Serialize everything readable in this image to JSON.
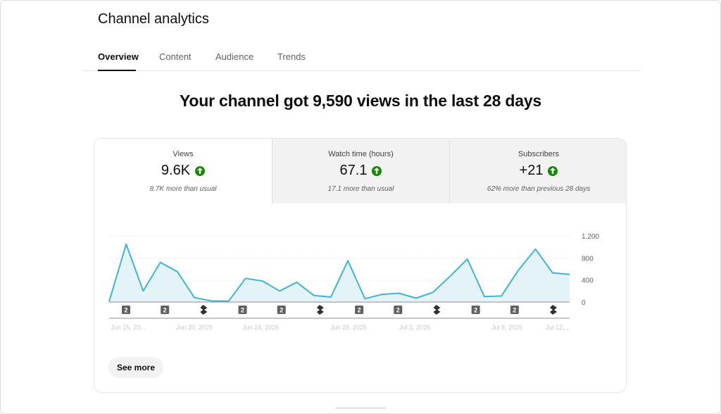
{
  "header": {
    "title": "Channel analytics"
  },
  "tabs": [
    {
      "label": "Overview",
      "active": true
    },
    {
      "label": "Content",
      "active": false
    },
    {
      "label": "Audience",
      "active": false
    },
    {
      "label": "Trends",
      "active": false
    }
  ],
  "headline": "Your channel got 9,590 views in the last 28 days",
  "metrics": [
    {
      "label": "Views",
      "value": "9.6K",
      "trend": "up-arrow-icon",
      "sub": "8.7K more than usual"
    },
    {
      "label": "Watch time (hours)",
      "value": "67.1",
      "trend": "up-arrow-icon",
      "sub": "17.1 more than usual"
    },
    {
      "label": "Subscribers",
      "value": "+21",
      "trend": "up-arrow-icon",
      "sub": "62% more than previous 28 days"
    }
  ],
  "colors": {
    "line": "#41b3d3",
    "fill": "#e3f3f8",
    "trend_up": "#108a00",
    "marker": "#606060"
  },
  "chart_data": {
    "type": "area",
    "series": [
      {
        "values": [
          10,
          1050,
          200,
          720,
          550,
          80,
          20,
          15,
          430,
          380,
          200,
          360,
          120,
          90,
          750,
          60,
          140,
          160,
          70,
          180,
          470,
          780,
          100,
          110,
          580,
          960,
          530,
          500
        ]
      }
    ],
    "y_ticks": [
      "1,200",
      "800",
      "400",
      "0"
    ],
    "ylim": [
      0,
      1200
    ],
    "x_tick_labels": [
      "Jun 15, 20...",
      "Jun 20, 2025",
      "Jun 24, 2025",
      "Jun 29, 2025",
      "Jul 3, 2025",
      "Jul 8, 2025",
      "Jul 12,..."
    ],
    "grid": true,
    "markers": [
      {
        "type": "count",
        "label": "2"
      },
      {
        "type": "count",
        "label": "2"
      },
      {
        "type": "shorts"
      },
      {
        "type": "count",
        "label": "2"
      },
      {
        "type": "count",
        "label": "2"
      },
      {
        "type": "shorts"
      },
      {
        "type": "count",
        "label": "2"
      },
      {
        "type": "count",
        "label": "2"
      },
      {
        "type": "shorts"
      },
      {
        "type": "count",
        "label": "2"
      },
      {
        "type": "count",
        "label": "2"
      },
      {
        "type": "shorts"
      }
    ]
  },
  "actions": {
    "see_more": "See more"
  }
}
